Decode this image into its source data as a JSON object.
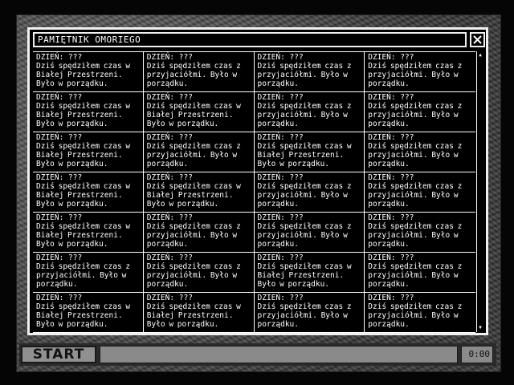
{
  "window": {
    "title": "PAMIĘTNIK OMORIEGO",
    "close_icon": "✕"
  },
  "diary": {
    "columns": [
      [
        {
          "day": "DZIEŃ: ???",
          "text": "Dziś spędziłem czas w Białej Przestrzeni. Było w porządku."
        },
        {
          "day": "DZIEŃ: ???",
          "text": "Dziś spędziłem czas w Białej Przestrzeni. Było w porządku."
        },
        {
          "day": "DZIEŃ: ???",
          "text": "Dziś spędziłem czas w Białej Przestrzeni. Było w porządku."
        },
        {
          "day": "DZIEŃ: ???",
          "text": "Dziś spędziłem czas w Białej Przestrzeni. Było w porządku."
        },
        {
          "day": "DZIEŃ: ???",
          "text": "Dziś spędziłem czas w Białej Przestrzeni. Było w porządku."
        },
        {
          "day": "DZIEŃ: ???",
          "text": "Dziś spędziłem czas z przyjaciółmi. Było w porządku."
        },
        {
          "day": "DZIEŃ: ???",
          "text": "Dziś spędziłem czas w Białej Przestrzeni. Było w porządku."
        }
      ],
      [
        {
          "day": "DZIEŃ: ???",
          "text": "Dziś spędziłem czas z przyjaciółmi. Było w porządku."
        },
        {
          "day": "DZIEŃ: ???",
          "text": "Dziś spędziłem czas w Białej Przestrzeni. Było w porządku."
        },
        {
          "day": "DZIEŃ: ???",
          "text": "Dziś spędziłem czas z przyjaciółmi. Było w porządku."
        },
        {
          "day": "DZIEŃ: ???",
          "text": "Dziś spędziłem czas w Białej Przestrzeni. Było w porządku."
        },
        {
          "day": "DZIEŃ: ???",
          "text": "Dziś spędziłem czas z przyjaciółmi. Było w porządku."
        },
        {
          "day": "DZIEŃ: ???",
          "text": "Dziś spędziłem czas z przyjaciółmi. Było w porządku."
        },
        {
          "day": "DZIEŃ: ???",
          "text": "Dziś spędziłem czas w Białej Przestrzeni. Było w porządku."
        }
      ],
      [
        {
          "day": "DZIEŃ: ???",
          "text": "Dziś spędziłem czas z przyjaciółmi. Było w porządku."
        },
        {
          "day": "DZIEŃ: ???",
          "text": "Dziś spędziłem czas z przyjaciółmi. Było w porządku."
        },
        {
          "day": "DZIEŃ: ???",
          "text": "Dziś spędziłem czas w Białej Przestrzeni. Było w porządku."
        },
        {
          "day": "DZIEŃ: ???",
          "text": "Dziś spędziłem czas z przyjaciółmi. Było w porządku."
        },
        {
          "day": "DZIEŃ: ???",
          "text": "Dziś spędziłem czas z przyjaciółmi. Było w porządku."
        },
        {
          "day": "DZIEŃ: ???",
          "text": "Dziś spędziłem czas w Białej Przestrzeni. Było w porządku."
        },
        {
          "day": "DZIEŃ: ???",
          "text": "Dziś spędziłem czas z przyjaciółmi. Było w porządku."
        }
      ],
      [
        {
          "day": "DZIEŃ: ???",
          "text": "Dziś spędziłem czas z przyjaciółmi. Było w porządku."
        },
        {
          "day": "DZIEŃ: ???",
          "text": "Dziś spędziłem czas z przyjaciółmi. Było w porządku."
        },
        {
          "day": "DZIEŃ: ???",
          "text": "Dziś spędziłem czas z przyjaciółmi. Było w porządku."
        },
        {
          "day": "DZIEŃ: ???",
          "text": "Dziś spędziłem czas z przyjaciółmi. Było w porządku."
        },
        {
          "day": "DZIEŃ: ???",
          "text": "Dziś spędziłem czas z przyjaciółmi. Było w porządku."
        },
        {
          "day": "DZIEŃ: ???",
          "text": "Dziś spędziłem czas z przyjaciółmi. Było w porządku."
        },
        {
          "day": "DZIEŃ: ???",
          "text": "Dziś spędziłem czas z przyjaciółmi. Było w porządku."
        }
      ]
    ]
  },
  "scrollbar": {
    "up_icon": "▲",
    "down_icon": "▼"
  },
  "taskbar": {
    "start_label": "START",
    "clock": "0:00"
  },
  "colors": {
    "window_bg": "#000000",
    "window_border": "#f0f0f0",
    "taskbar_gray": "#8a8a8a"
  }
}
